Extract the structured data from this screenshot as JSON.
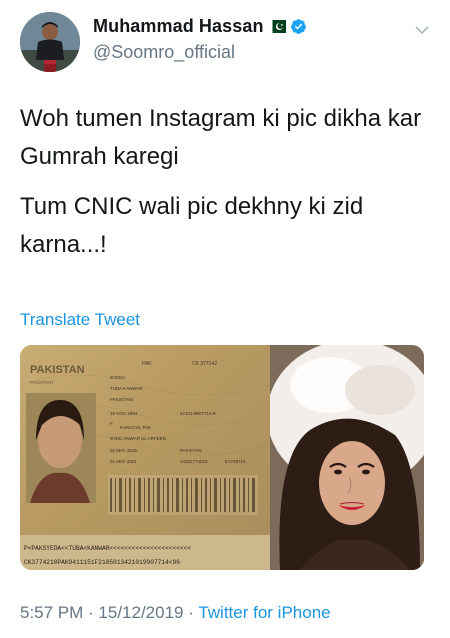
{
  "user": {
    "display_name": "Muhammad Hassan",
    "handle": "@Soomro_official",
    "avatar_icon": "profile-photo",
    "flag_icon": "pakistan-flag-icon",
    "verified_icon": "verified-badge-icon"
  },
  "tweet": {
    "lines": [
      "Woh tumen Instagram ki pic dikha kar Gumrah karegi",
      "Tum CNIC wali pic dekhny ki zid karna...!"
    ],
    "translate_label": "Translate Tweet"
  },
  "media": {
    "passport": {
      "country": "PAKISTAN",
      "type": "PASSPORT",
      "field_pak": "PAK",
      "passport_no": "CK 377142",
      "surname": "SYEDA",
      "given_name": "TUBA KANWAR",
      "nationality": "PAKISTANI",
      "dob": "15 NOV 1994",
      "sex": "F",
      "place": "KARACHI, PAK",
      "cnic": "42101-9907714-8",
      "father": "SYED ANWAR UL ARFEEN",
      "issue": "02 MAY 2016",
      "authority": "PAKISTAN",
      "expiry": "01 MAY 2021",
      "tracking": "10321774015",
      "booklet": "E7749715",
      "mrz1": "P<PAKSYEDA<<TUBA<KANWAR<<<<<<<<<<<<<<<<<<<<<<",
      "mrz2": "CK3774210PAK9411151F2105013421019907714<96"
    }
  },
  "footer": {
    "time": "5:57 PM",
    "separator": " · ",
    "date": "15/12/2019",
    "client": "Twitter for iPhone"
  },
  "colors": {
    "text": "#14171a",
    "secondary": "#657786",
    "link": "#1b95e0",
    "verified": "#1da1f2",
    "flag_green": "#01411c"
  }
}
